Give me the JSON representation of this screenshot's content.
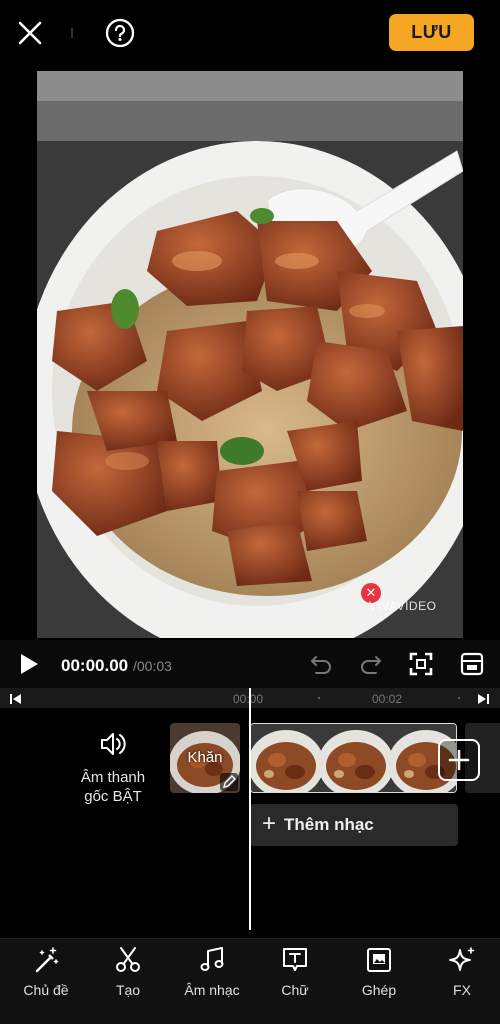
{
  "header": {
    "save_label": "LƯU"
  },
  "preview": {
    "watermark": "VIVAVIDEO"
  },
  "player": {
    "current_time": "00:00.00",
    "total_time": "/00:03"
  },
  "ruler": {
    "tick_1": "00:00",
    "tick_2": "00:02"
  },
  "timeline": {
    "audio_label_1": "Âm thanh",
    "audio_label_2": "gốc BẬT",
    "cover_label": "Khăn",
    "add_music_label": "Thêm nhạc"
  },
  "tabs": [
    {
      "label": "Chủ đề",
      "icon": "magic-wand-icon"
    },
    {
      "label": "Tạo",
      "icon": "scissors-icon"
    },
    {
      "label": "Âm nhạc",
      "icon": "music-note-icon"
    },
    {
      "label": "Chữ",
      "icon": "text-icon"
    },
    {
      "label": "Ghép",
      "icon": "picture-in-picture-icon"
    },
    {
      "label": "FX",
      "icon": "sparkle-icon"
    }
  ],
  "colors": {
    "accent": "#f5a623",
    "background": "#000000",
    "watermark_close": "#e8343f"
  }
}
